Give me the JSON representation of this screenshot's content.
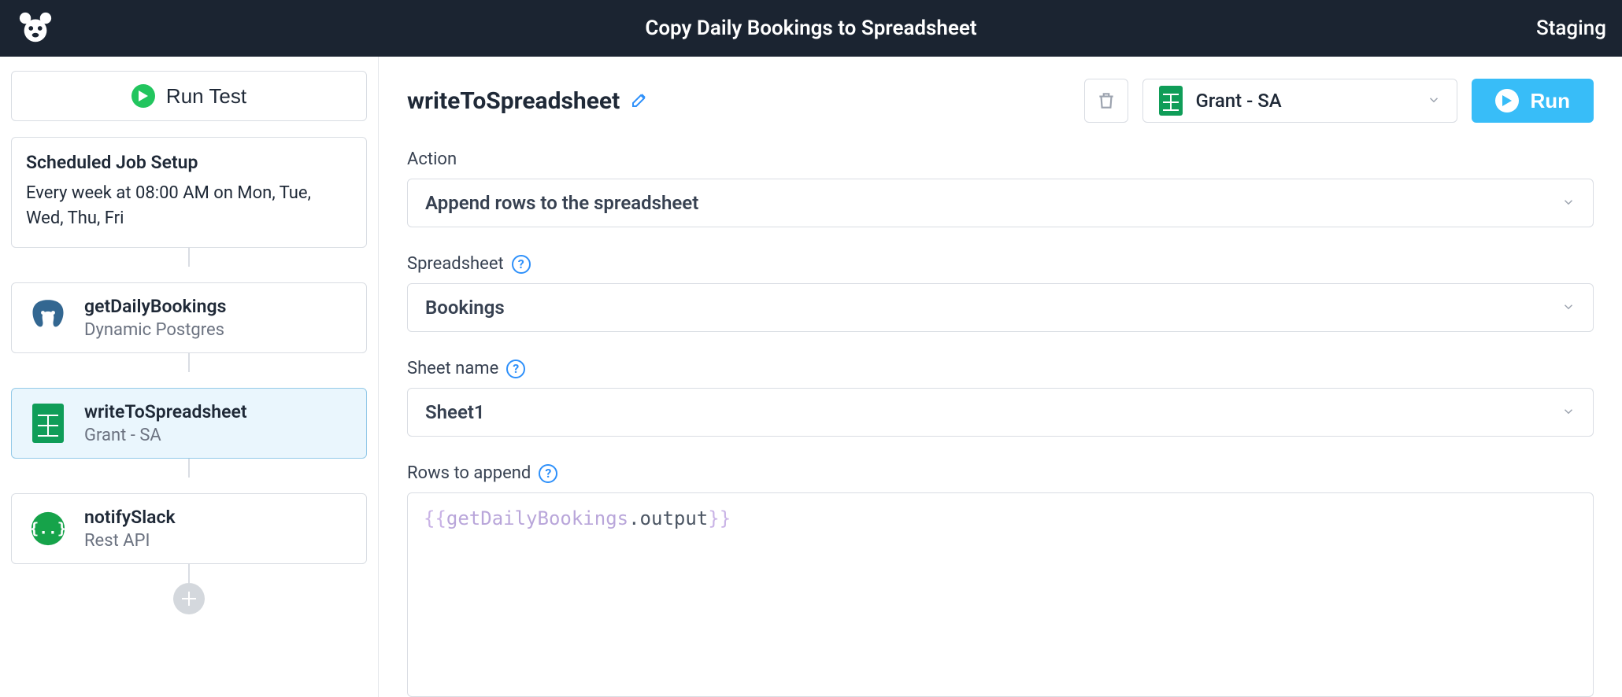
{
  "header": {
    "title": "Copy Daily Bookings to Spreadsheet",
    "environment": "Staging"
  },
  "sidebar": {
    "run_test_label": "Run Test",
    "schedule": {
      "title": "Scheduled Job Setup",
      "description": "Every week at 08:00 AM on Mon, Tue, Wed, Thu, Fri"
    },
    "steps": [
      {
        "name": "getDailyBookings",
        "integration": "Dynamic Postgres",
        "icon": "postgres",
        "active": false
      },
      {
        "name": "writeToSpreadsheet",
        "integration": "Grant - SA",
        "icon": "sheets",
        "active": true
      },
      {
        "name": "notifySlack",
        "integration": "Rest API",
        "icon": "restapi",
        "active": false
      }
    ]
  },
  "detail": {
    "title": "writeToSpreadsheet",
    "account": "Grant - SA",
    "run_label": "Run",
    "fields": {
      "action": {
        "label": "Action",
        "value": "Append rows to the spreadsheet"
      },
      "spreadsheet": {
        "label": "Spreadsheet",
        "value": "Bookings"
      },
      "sheet_name": {
        "label": "Sheet name",
        "value": "Sheet1"
      },
      "rows": {
        "label": "Rows to append",
        "expression": {
          "open": "{{",
          "var": "getDailyBookings",
          "prop": ".output",
          "close": "}}"
        }
      }
    }
  }
}
